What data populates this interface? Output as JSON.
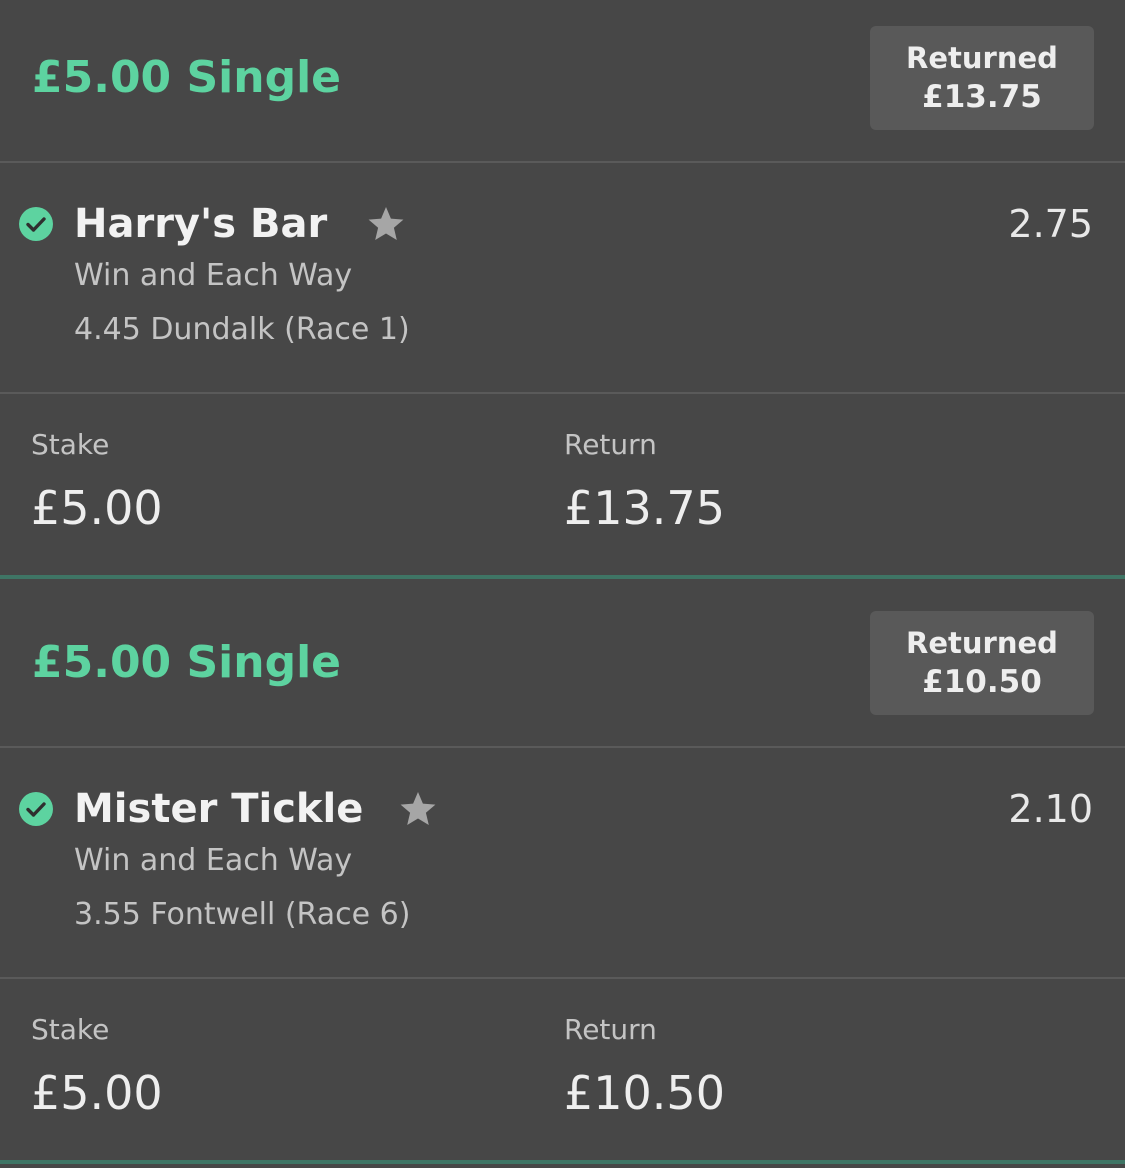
{
  "bets": [
    {
      "title": "£5.00 Single",
      "returned_label": "Returned",
      "returned_amount": "£13.75",
      "selection": {
        "name": "Harry's Bar",
        "odds": "2.75",
        "market": "Win and Each Way",
        "event": "4.45 Dundalk (Race 1)",
        "status_icon": "check-circle-icon",
        "favourite_icon": "star-icon"
      },
      "stake_label": "Stake",
      "stake_value": "£5.00",
      "return_label": "Return",
      "return_value": "£13.75"
    },
    {
      "title": "£5.00 Single",
      "returned_label": "Returned",
      "returned_amount": "£10.50",
      "selection": {
        "name": "Mister Tickle",
        "odds": "2.10",
        "market": "Win and Each Way",
        "event": "3.55 Fontwell (Race 6)",
        "status_icon": "check-circle-icon",
        "favourite_icon": "star-icon"
      },
      "stake_label": "Stake",
      "stake_value": "£5.00",
      "return_label": "Return",
      "return_value": "£10.50"
    }
  ],
  "colors": {
    "background": "#474747",
    "accent_green": "#5dd3a0",
    "divider_green": "#3f7565",
    "returned_box": "#595959"
  }
}
